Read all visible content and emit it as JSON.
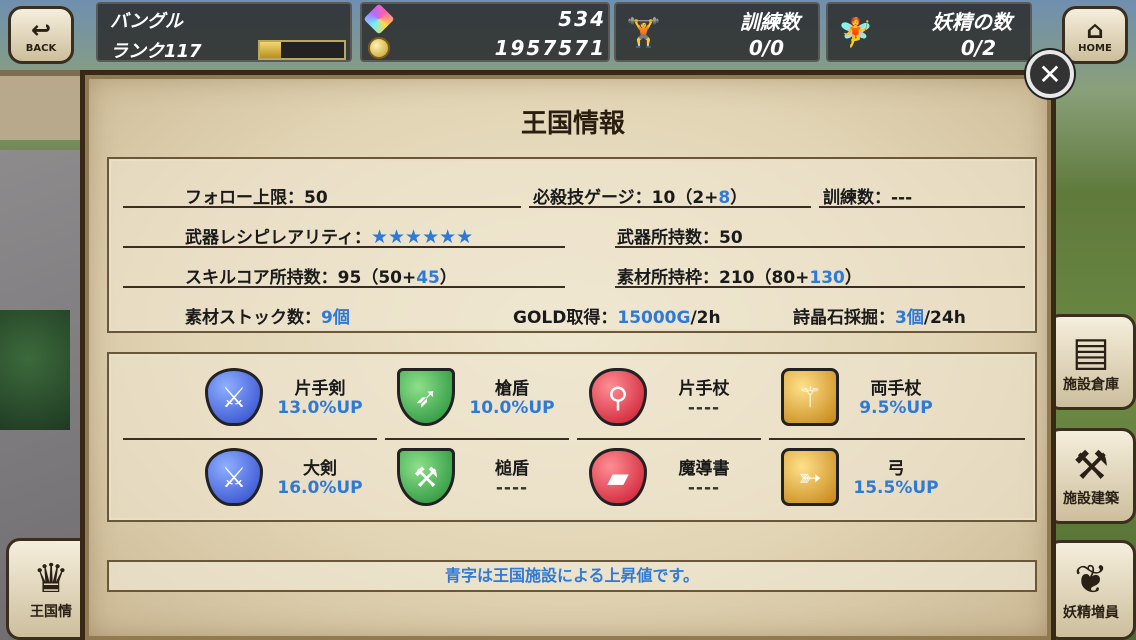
{
  "header": {
    "back_label": "BACK",
    "home_label": "HOME",
    "player_name": "バングル",
    "rank_label": "ランク117",
    "rank_progress": 0.25,
    "gems": "534",
    "gold": "1957571",
    "training_label": "訓練数",
    "training_value": "0/0",
    "fairy_label": "妖精の数",
    "fairy_value": "0/2"
  },
  "side": {
    "left_bottom": "王国情",
    "right_1": "施設倉庫",
    "right_2": "施設建築",
    "right_3": "妖精増員"
  },
  "dialog": {
    "title": "王国情報",
    "stats": {
      "follow_limit": "フォロー上限：50",
      "gauge_prefix": "必殺技ゲージ：10（2+",
      "gauge_blue": "8",
      "gauge_suffix": "）",
      "training": "訓練数：---",
      "rarity_label": "武器レシピレアリティ：",
      "rarity_stars": "★★★★★★",
      "weapons_owned": "武器所持数：50",
      "skillcore_prefix": "スキルコア所持数：95（50+",
      "skillcore_blue": "45",
      "skillcore_suffix": "）",
      "material_prefix": "素材所持枠：210（80+",
      "material_blue": "130",
      "material_suffix": "）",
      "stock_prefix": "素材ストック数：",
      "stock_blue": "9個",
      "gold_prefix": "GOLD取得：",
      "gold_blue": "15000G",
      "gold_suffix": "/2h",
      "crystal_prefix": "詩晶石採掘：",
      "crystal_blue": "3個",
      "crystal_suffix": "/24h"
    },
    "weapons": [
      {
        "name": "片手剣",
        "value": "13.0%UP",
        "icon": "sword-icon",
        "color": "#2a44c8"
      },
      {
        "name": "槍盾",
        "value": "10.0%UP",
        "icon": "spear-shield-icon",
        "color": "#1e8a34"
      },
      {
        "name": "片手杖",
        "value": "----",
        "icon": "wand-icon",
        "color": "#c8142a"
      },
      {
        "name": "両手杖",
        "value": "9.5%UP",
        "icon": "staff-icon",
        "color": "#c48414"
      },
      {
        "name": "大剣",
        "value": "16.0%UP",
        "icon": "greatsword-icon",
        "color": "#2a44c8"
      },
      {
        "name": "槌盾",
        "value": "----",
        "icon": "hammer-shield-icon",
        "color": "#1e8a34"
      },
      {
        "name": "魔導書",
        "value": "----",
        "icon": "grimoire-icon",
        "color": "#c8142a"
      },
      {
        "name": "弓",
        "value": "15.5%UP",
        "icon": "bow-icon",
        "color": "#c48414"
      }
    ],
    "note": "青字は王国施設による上昇値です。"
  }
}
